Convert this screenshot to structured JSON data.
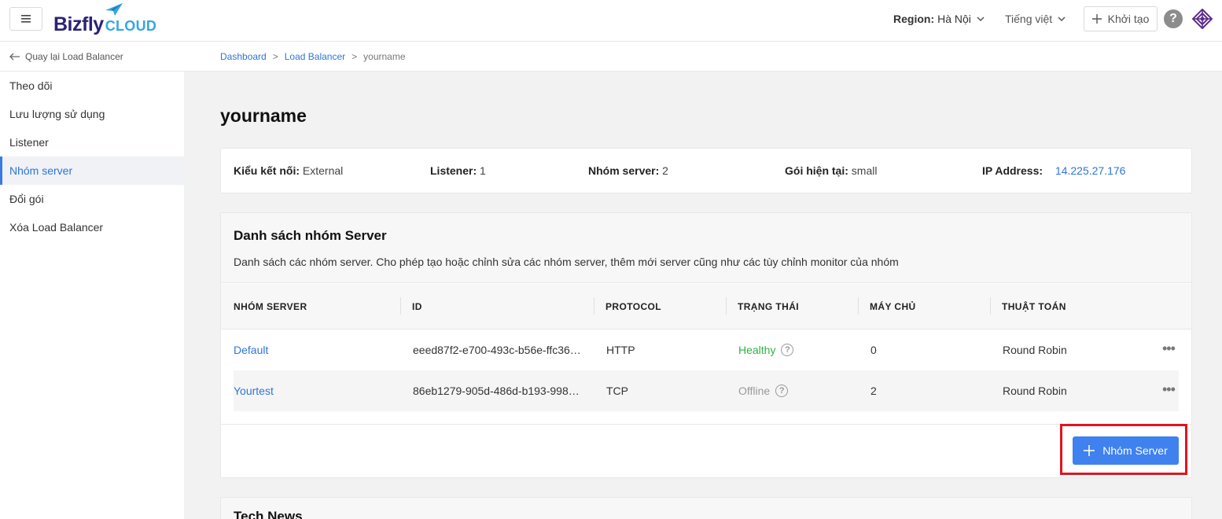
{
  "header": {
    "logo_text": "Bizfly",
    "logo_sub": "CLOUD",
    "region_label": "Region:",
    "region_value": "Hà Nội",
    "language": "Tiếng việt",
    "create_label": "Khởi tạo",
    "help_symbol": "?"
  },
  "sidebar": {
    "back_label": "Quay lại Load Balancer",
    "items": [
      {
        "label": "Theo dõi"
      },
      {
        "label": "Lưu lượng sử dụng"
      },
      {
        "label": "Listener"
      },
      {
        "label": "Nhóm server"
      },
      {
        "label": "Đổi gói"
      },
      {
        "label": "Xóa Load Balancer"
      }
    ],
    "active_index": 3
  },
  "breadcrumb": {
    "items": [
      "Dashboard",
      "Load Balancer",
      "yourname"
    ],
    "separator": ">"
  },
  "page": {
    "title": "yourname"
  },
  "info": {
    "connection_label": "Kiểu kết nối:",
    "connection_value": "External",
    "listener_label": "Listener:",
    "listener_value": "1",
    "group_label": "Nhóm server:",
    "group_value": "2",
    "plan_label": "Gói hiện tại:",
    "plan_value": "small",
    "ip_label": "IP Address:",
    "ip_value": "14.225.27.176"
  },
  "server_groups": {
    "title": "Danh sách nhóm Server",
    "description": "Danh sách các nhóm server. Cho phép tạo hoặc chỉnh sửa các nhóm server, thêm mới server cũng như các tùy chỉnh monitor của nhóm",
    "columns": [
      "NHÓM SERVER",
      "ID",
      "PROTOCOL",
      "TRẠNG THÁI",
      "MÁY CHỦ",
      "THUẬT TOÁN"
    ],
    "rows": [
      {
        "name": "Default",
        "id": "eeed87f2-e700-493c-b56e-ffc36…",
        "protocol": "HTTP",
        "status": "Healthy",
        "servers": "0",
        "algorithm": "Round Robin"
      },
      {
        "name": "Yourtest",
        "id": "86eb1279-905d-486d-b193-998…",
        "protocol": "TCP",
        "status": "Offline",
        "servers": "2",
        "algorithm": "Round Robin"
      }
    ],
    "add_button": "Nhóm Server"
  },
  "news": {
    "title": "Tech News"
  },
  "colors": {
    "accent": "#3f81ef",
    "link": "#2e75d8",
    "healthy": "#2fb344",
    "offline": "#9a9a9a",
    "highlight": "#e0141f"
  }
}
